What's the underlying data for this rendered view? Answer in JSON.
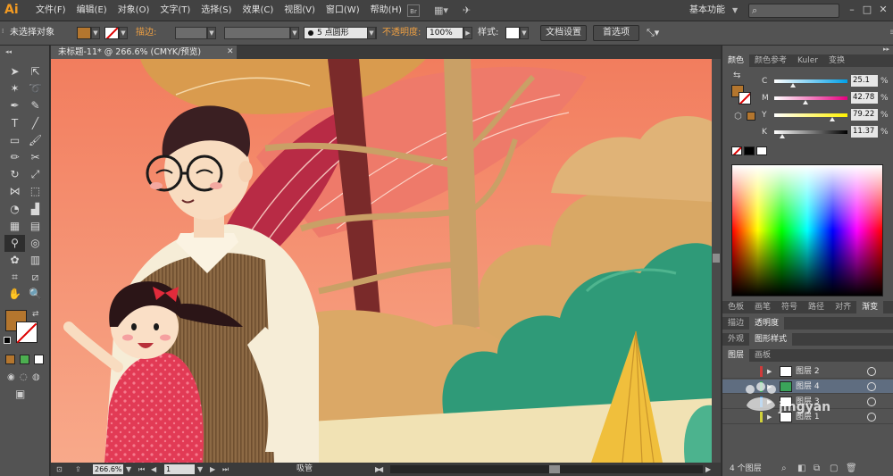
{
  "app": {
    "logo": "Ai"
  },
  "menu": [
    "文件(F)",
    "编辑(E)",
    "对象(O)",
    "文字(T)",
    "选择(S)",
    "效果(C)",
    "视图(V)",
    "窗口(W)",
    "帮助(H)"
  ],
  "menubar": {
    "workspace": "基本功能",
    "bridge_label": "Br"
  },
  "control_bar": {
    "selection_status": "未选择对象",
    "stroke_label": "描边:",
    "brush_label": "5 点圆形",
    "opacity_label": "不透明度:",
    "opacity_value": "100%",
    "style_label": "样式:",
    "doc_setup_button": "文档设置",
    "prefs_button": "首选项"
  },
  "document": {
    "tab_title": "未标题-11* @ 266.6% (CMYK/预览)"
  },
  "status_bar": {
    "zoom": "266.6%",
    "artboard": "1",
    "tool": "吸管"
  },
  "color_panel": {
    "tabs": [
      "颜色",
      "颜色参考",
      "Kuler",
      "变换"
    ],
    "channels": [
      {
        "label": "C",
        "value": "25.1",
        "pct": "%",
        "fraction": 0.251,
        "gradient": [
          "#ffffff",
          "#00a0e8"
        ]
      },
      {
        "label": "M",
        "value": "42.78",
        "pct": "%",
        "fraction": 0.428,
        "gradient": [
          "#ffffff",
          "#e4007f"
        ]
      },
      {
        "label": "Y",
        "value": "79.22",
        "pct": "%",
        "fraction": 0.792,
        "gradient": [
          "#ffffff",
          "#fff100"
        ]
      },
      {
        "label": "K",
        "value": "11.37",
        "pct": "%",
        "fraction": 0.114,
        "gradient": [
          "#ffffff",
          "#000000"
        ]
      }
    ],
    "fill_color": "#b4762e"
  },
  "mid_panel": {
    "tabs": [
      "色板",
      "画笔",
      "符号",
      "路径",
      "对齐",
      "渐变"
    ]
  },
  "appearance_panel": {
    "tabs": [
      "描边",
      "透明度"
    ]
  },
  "graphic_styles_panel": {
    "tabs": [
      "外观",
      "图形样式"
    ]
  },
  "layers_panel": {
    "tabs": [
      "图层",
      "画板"
    ],
    "layers": [
      {
        "name": "图层 2",
        "color": "#d13a3a"
      },
      {
        "name": "图层 4",
        "color": "#3aa35a"
      },
      {
        "name": "图层 3",
        "color": "#3a8ad1"
      },
      {
        "name": "图层 1",
        "color": "#d1d13a"
      }
    ],
    "count": "4 个图层"
  },
  "watermark": {
    "text": "jingyan"
  }
}
